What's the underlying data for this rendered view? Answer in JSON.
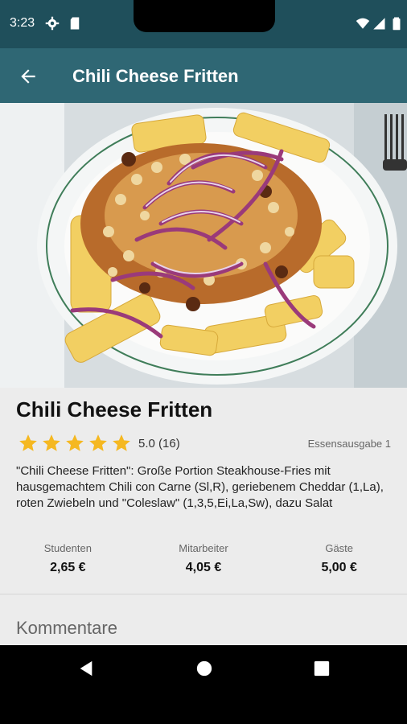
{
  "status_bar": {
    "time": "3:23",
    "icons": [
      "settings-icon",
      "sd-card-icon",
      "wifi-icon",
      "signal-icon",
      "battery-icon"
    ]
  },
  "app_bar": {
    "title": "Chili Cheese Fritten",
    "back_icon": "arrow-back-icon"
  },
  "dish": {
    "name": "Chili Cheese Fritten",
    "rating_stars": 5,
    "rating_text": "5.0 (16)",
    "location": "Essensausgabe 1",
    "description": "\"Chili Cheese Fritten\": Große Portion Steakhouse-Fries mit hausgemachtem Chili con Carne (Sl,R), geriebenem Cheddar (1,La), roten Zwiebeln und \"Coleslaw\" (1,3,5,Ei,La,Sw), dazu Salat",
    "prices": [
      {
        "label": "Studenten",
        "value": "2,65 €"
      },
      {
        "label": "Mitarbeiter",
        "value": "4,05 €"
      },
      {
        "label": "Gäste",
        "value": "5,00 €"
      }
    ],
    "comments_heading": "Kommentare"
  },
  "colors": {
    "status_bar": "#1f4f5b",
    "app_bar": "#2f6774",
    "star": "#f5b821",
    "content_bg": "#ececec"
  },
  "nav_bar": {
    "buttons": [
      "back-triangle-icon",
      "home-circle-icon",
      "recents-square-icon"
    ]
  }
}
